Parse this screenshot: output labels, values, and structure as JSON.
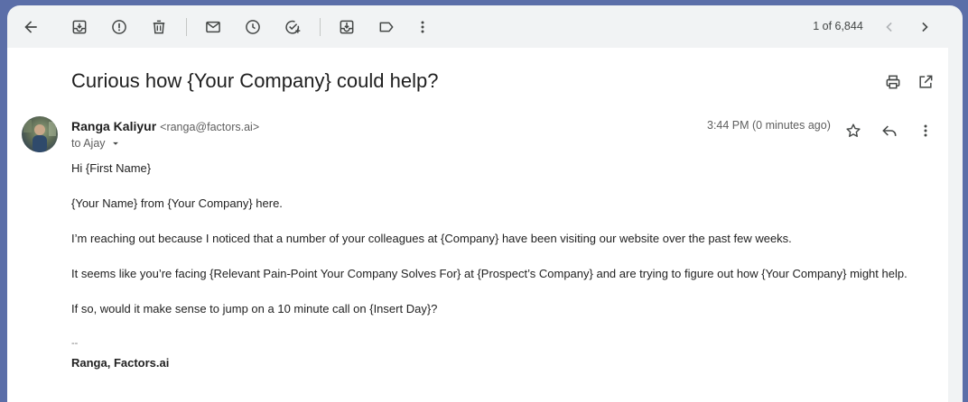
{
  "toolbar": {
    "icons": [
      "back-arrow-icon",
      "archive-icon",
      "report-spam-icon",
      "delete-icon",
      "mark-unread-icon",
      "snooze-icon",
      "add-task-icon",
      "move-to-icon",
      "label-icon",
      "more-vert-icon"
    ],
    "page_count": "1 of 6,844"
  },
  "email": {
    "subject": "Curious how {Your Company} could help?",
    "sender_name": "Ranga Kaliyur",
    "sender_email": "<ranga@factors.ai>",
    "to": "to Ajay",
    "time": "3:44 PM (0 minutes ago)",
    "body": [
      "Hi {First Name}",
      "{Your Name} from {Your Company} here.",
      "I’m reaching out because I noticed that a number of your colleagues at {Company} have been visiting our website over the past few weeks.",
      "It seems like you’re facing {Relevant Pain-Point Your Company Solves For} at {Prospect’s Company} and are trying to figure out how {Your Company} might help.",
      "If so, would it make sense to jump on a 10 minute call on {Insert Day}?"
    ],
    "sig_dash": "--",
    "signature": "Ranga, Factors.ai"
  }
}
